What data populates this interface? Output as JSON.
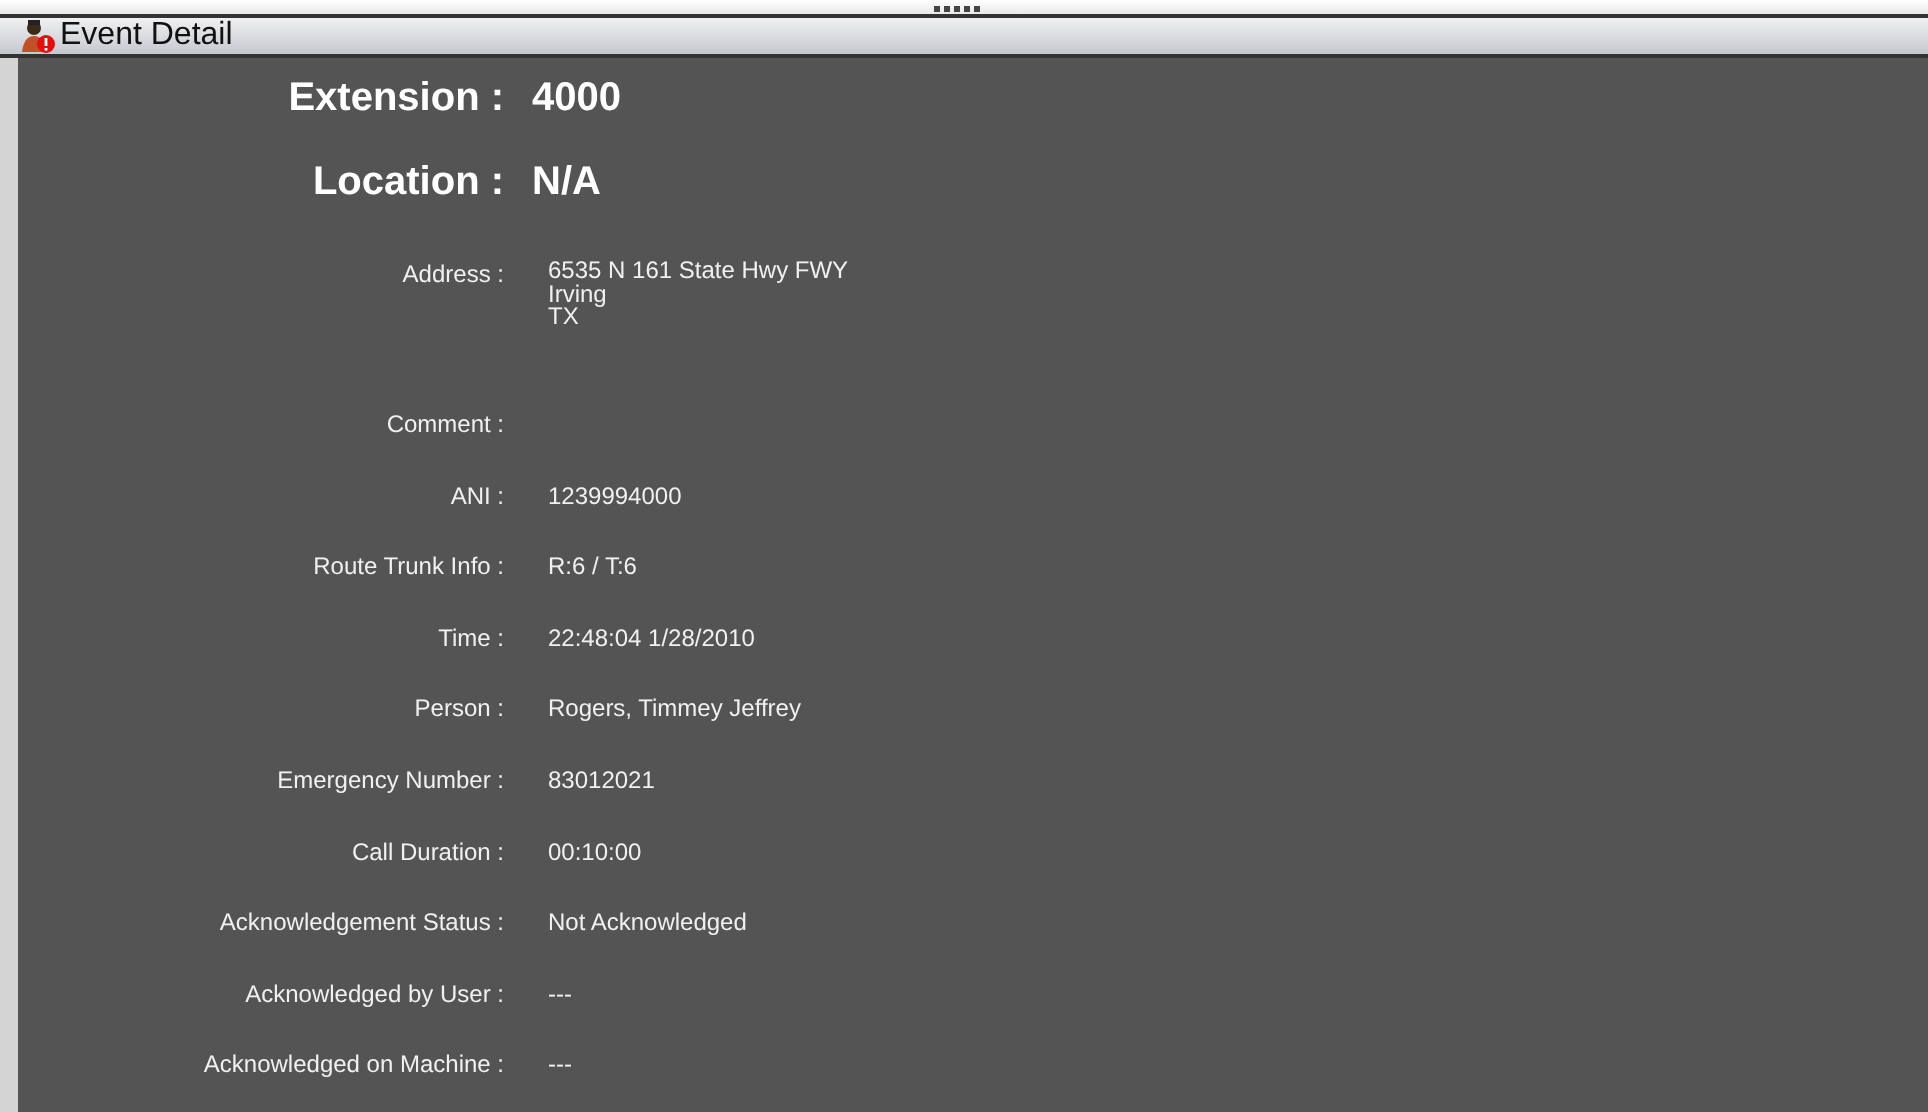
{
  "window": {
    "title": "Event Detail"
  },
  "rows": [
    {
      "kind": "heading",
      "label": "Extension :",
      "value": "4000"
    },
    {
      "kind": "heading",
      "label": "Location :",
      "value": "N/A"
    },
    {
      "kind": "field",
      "label": "Address :",
      "lines": [
        "6535 N 161 State Hwy FWY",
        "Irving",
        "TX"
      ]
    },
    {
      "kind": "field",
      "label": "Comment :"
    },
    {
      "kind": "field",
      "label": "ANI :",
      "value": "1239994000"
    },
    {
      "kind": "field",
      "label": "Route Trunk Info :",
      "value": "R:6 / T:6"
    },
    {
      "kind": "field",
      "label": "Time :",
      "value": "22:48:04 1/28/2010"
    },
    {
      "kind": "field",
      "label": "Person :",
      "value": "Rogers, Timmey Jeffrey"
    },
    {
      "kind": "field",
      "label": "Emergency Number :",
      "value": "83012021"
    },
    {
      "kind": "field",
      "label": "Call Duration :",
      "value": "00:10:00"
    },
    {
      "kind": "field",
      "label": "Acknowledgement Status :",
      "value": "Not Acknowledged"
    },
    {
      "kind": "field",
      "label": "Acknowledged by User :",
      "value": "---"
    },
    {
      "kind": "field",
      "label": "Acknowledged on Machine :",
      "value": "---"
    }
  ]
}
